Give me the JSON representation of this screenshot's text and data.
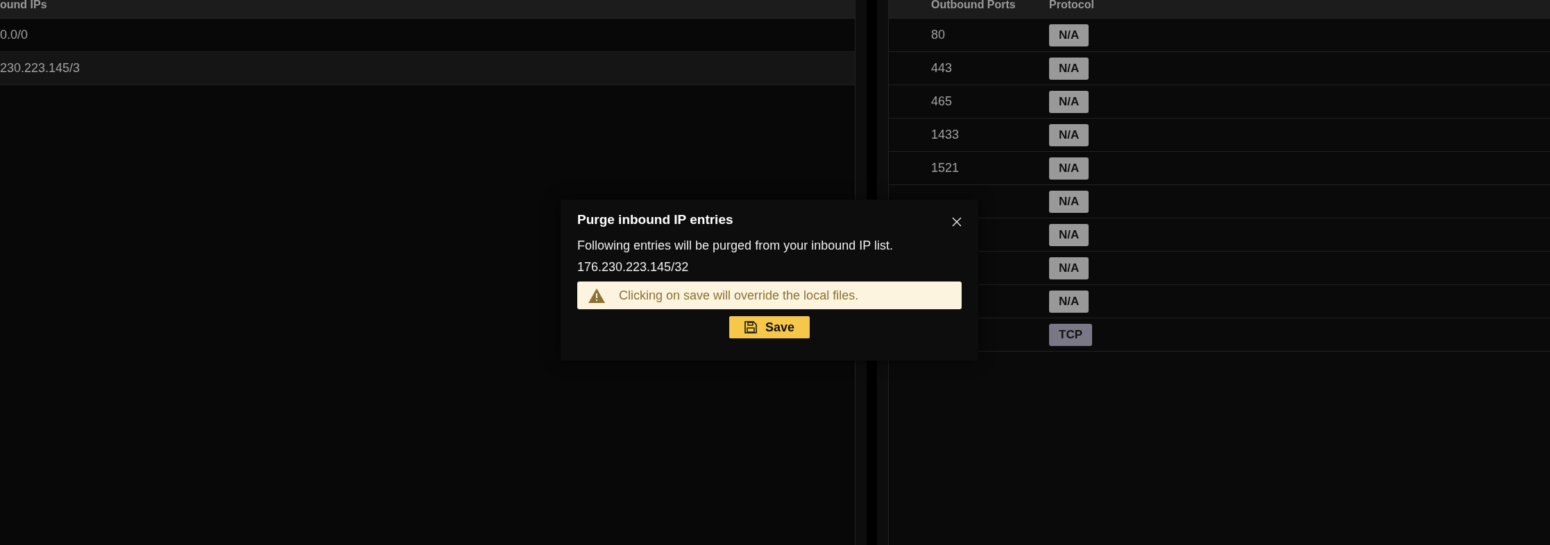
{
  "inbound_table": {
    "columns": [
      "ound IPs"
    ],
    "rows": [
      {
        "ip": "0.0/0",
        "selected": false
      },
      {
        "ip": "230.223.145/3",
        "selected": true
      }
    ]
  },
  "outbound_table": {
    "columns": [
      "Outbound Ports",
      "Protocol"
    ],
    "rows": [
      {
        "port": "80",
        "protocol": "N/A",
        "kind": "none"
      },
      {
        "port": "443",
        "protocol": "N/A",
        "kind": "none"
      },
      {
        "port": "465",
        "protocol": "N/A",
        "kind": "none"
      },
      {
        "port": "1433",
        "protocol": "N/A",
        "kind": "none"
      },
      {
        "port": "1521",
        "protocol": "N/A",
        "kind": "none"
      },
      {
        "protocol": "N/A",
        "kind": "none"
      },
      {
        "protocol": "N/A",
        "kind": "none"
      },
      {
        "protocol": "N/A",
        "kind": "none"
      },
      {
        "protocol": "N/A",
        "kind": "none"
      },
      {
        "protocol": "TCP",
        "kind": "tcp"
      }
    ]
  },
  "dialog": {
    "title": "Purge inbound IP entries",
    "message": "Following entries will be purged from your inbound IP list.",
    "entries": [
      "176.230.223.145/32"
    ],
    "warning": "Clicking on save will override the local files.",
    "button": "Save"
  }
}
